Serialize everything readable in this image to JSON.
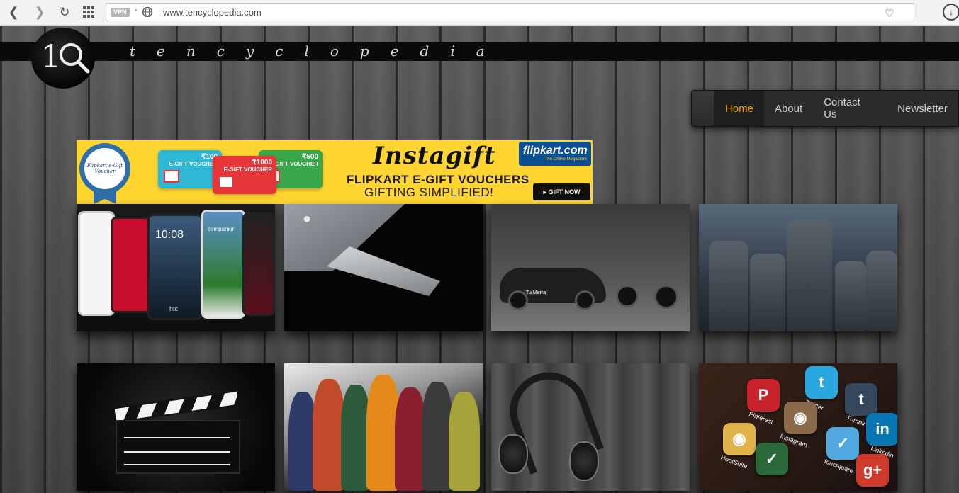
{
  "browser": {
    "vpn_label": "VPN",
    "url": "www.tencyclopedia.com"
  },
  "site": {
    "logo_text": "1Q",
    "tagline": "tencyclopedia"
  },
  "menu": {
    "items": [
      {
        "label": "Home",
        "active": true
      },
      {
        "label": "About"
      },
      {
        "label": "Contact Us"
      },
      {
        "label": "Newsletter"
      }
    ],
    "active_color": "#f0a000"
  },
  "banner": {
    "badge_text": "Flipkart e-Gift Voucher",
    "cards": [
      {
        "amount": "₹100",
        "label": "E-GIFT VOUCHER"
      },
      {
        "amount": "₹500",
        "label": "E-GIFT VOUCHER"
      },
      {
        "amount": "₹1000",
        "label": "E-GIFT VOUCHER"
      }
    ],
    "title": "Instagift",
    "line1": "FLIPKART E-GIFT VOUCHERS",
    "line2": "GIFTING SIMPLIFIED!",
    "brand": "flipkart.com",
    "brand_sub": "The Online Megastore",
    "cta": "GIFT NOW",
    "background": "#ffd631"
  },
  "tiles": {
    "phones": {
      "time": "10:08",
      "brand": "htc",
      "companion": "companion"
    },
    "car": {
      "plate": "Tu Merra"
    },
    "apps": [
      {
        "label": "Pinterest"
      },
      {
        "label": "Twitter"
      },
      {
        "label": "Tumblr"
      },
      {
        "label": "Instagram"
      },
      {
        "label": "HootSuite"
      },
      {
        "label": "foursquare"
      },
      {
        "label": "Linkedin"
      }
    ]
  }
}
